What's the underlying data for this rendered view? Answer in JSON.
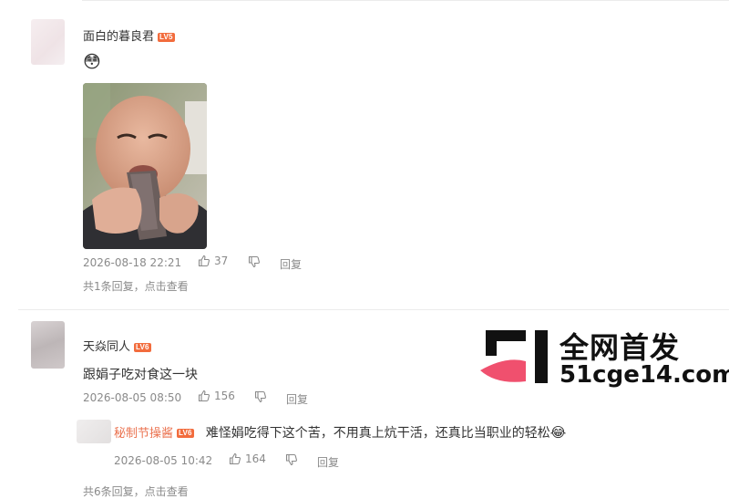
{
  "comments": [
    {
      "username": "面白的暮良君",
      "level": "LV5",
      "emoji": "😳",
      "timestamp": "2026-08-18 22:21",
      "likes": "37",
      "reply_label": "回复",
      "thread_summary": "共1条回复，点击查看"
    },
    {
      "username": "天焱同人",
      "level": "LV6",
      "text": "跟娟子吃对食这一块",
      "timestamp": "2026-08-05 08:50",
      "likes": "156",
      "reply_label": "回复",
      "reply": {
        "username": "秘制节操酱",
        "level": "LV6",
        "text": "难怪娟吃得下这个苦，不用真上炕干活，还真比当职业的轻松",
        "emoji": "😂",
        "timestamp": "2026-08-05 10:42",
        "likes": "164",
        "reply_label": "回复"
      },
      "thread_summary": "共6条回复，点击查看"
    }
  ],
  "watermark": {
    "title": "全网首发",
    "url": "51cge14.com"
  },
  "colors": {
    "level_badge": "#f26c3d",
    "reply_username": "#eb7350",
    "meta_text": "#8a8a8a",
    "watermark_pink": "#f0506e"
  }
}
